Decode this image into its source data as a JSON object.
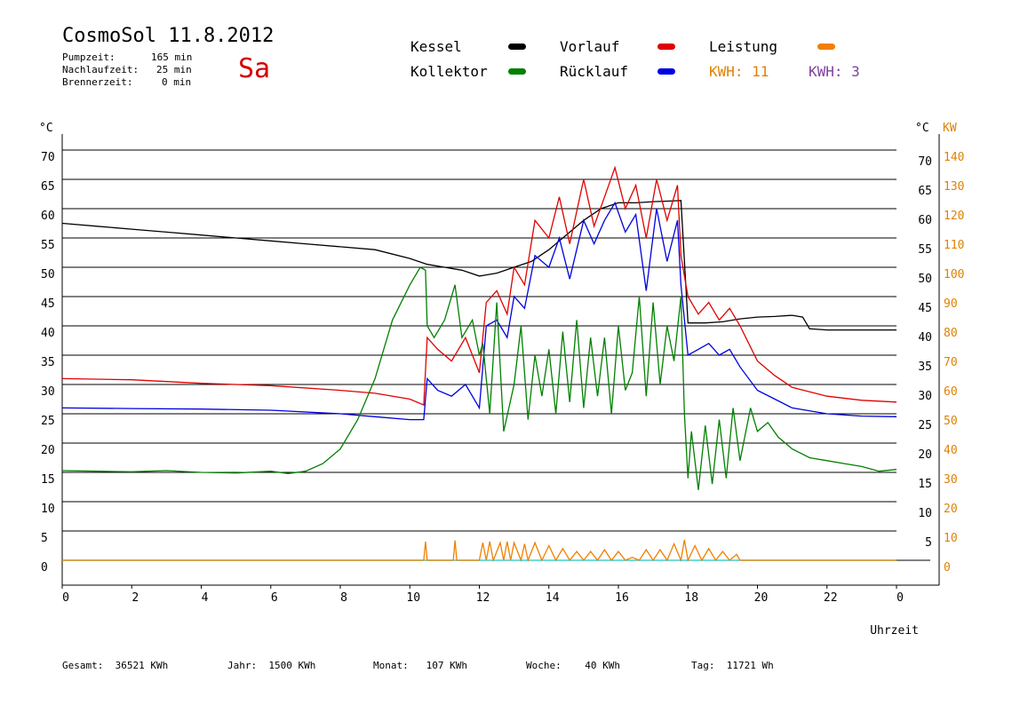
{
  "header": {
    "title": "CosmoSol 11.8.2012",
    "day": "Sa",
    "info": [
      {
        "label": "Pumpzeit:",
        "value": "165 min"
      },
      {
        "label": "Nachlaufzeit:",
        "value": "25 min"
      },
      {
        "label": "Brennerzeit:",
        "value": "0 min"
      }
    ]
  },
  "legend": {
    "kessel": {
      "label": "Kessel",
      "color": "#000000"
    },
    "vorlauf": {
      "label": "Vorlauf",
      "color": "#e00000"
    },
    "leistung": {
      "label": "Leistung",
      "color": "#f08000"
    },
    "kollektor": {
      "label": "Kollektor",
      "color": "#008000"
    },
    "ruecklauf": {
      "label": "Rücklauf",
      "color": "#0000e0"
    },
    "kwh1": {
      "label": "KWH:",
      "value": "11",
      "color": "#e08000"
    },
    "kwh2": {
      "label": "KWH:",
      "value": "3",
      "color": "#8040a0"
    }
  },
  "footer": {
    "gesamt": {
      "label": "Gesamt:",
      "value": "36521 KWh"
    },
    "jahr": {
      "label": "Jahr:",
      "value": "1500 KWh"
    },
    "monat": {
      "label": "Monat:",
      "value": "107 KWh"
    },
    "woche": {
      "label": "Woche:",
      "value": "40 KWh"
    },
    "tag": {
      "label": "Tag:",
      "value": "11721 Wh"
    }
  },
  "chart_data": {
    "type": "line",
    "xlabel": "Uhrzeit",
    "ylabel_left": "°C",
    "ylabel_right_1": "°C",
    "ylabel_right_2": "KW",
    "x_ticks": [
      "0",
      "2",
      "4",
      "6",
      "8",
      "10",
      "12",
      "14",
      "16",
      "18",
      "20",
      "22",
      "0"
    ],
    "xlim": [
      0,
      24
    ],
    "y_ticks_left": [
      "0",
      "5",
      "10",
      "15",
      "20",
      "25",
      "30",
      "35",
      "40",
      "45",
      "50",
      "55",
      "60",
      "65",
      "70"
    ],
    "y_ticks_right_1": [
      "5",
      "10",
      "15",
      "20",
      "25",
      "30",
      "35",
      "40",
      "45",
      "50",
      "55",
      "60",
      "65",
      "70"
    ],
    "y_ticks_right_2": [
      "0",
      "10",
      "20",
      "30",
      "40",
      "50",
      "60",
      "70",
      "80",
      "90",
      "100",
      "110",
      "120",
      "130",
      "140"
    ],
    "ylim": [
      0,
      70
    ],
    "grid": true,
    "series": [
      {
        "name": "Kessel",
        "color": "#000000",
        "x": [
          0,
          1,
          2,
          3,
          4,
          5,
          6,
          7,
          8,
          9,
          10,
          10.5,
          11,
          11.5,
          12,
          12.2,
          12.5,
          13,
          13.5,
          14,
          14.5,
          15,
          15.5,
          16,
          16.5,
          17,
          17.5,
          17.8,
          18,
          18.5,
          19,
          19.5,
          20,
          20.5,
          21,
          21.3,
          21.5,
          22,
          23,
          24
        ],
        "y": [
          57.5,
          57,
          56.5,
          56,
          55.5,
          55,
          54.5,
          54,
          53.5,
          53,
          51.5,
          50.5,
          50,
          49.5,
          48.5,
          48.7,
          49,
          50,
          51,
          53,
          55.5,
          58,
          60,
          61,
          61,
          61.2,
          61.3,
          61.4,
          40.5,
          40.5,
          40.7,
          41.2,
          41.5,
          41.6,
          41.8,
          41.5,
          39.5,
          39.3,
          39.3,
          39.3
        ]
      },
      {
        "name": "Vorlauf",
        "color": "#e00000",
        "x": [
          0,
          2,
          4,
          6,
          8,
          9,
          10,
          10.4,
          10.5,
          10.8,
          11.2,
          11.6,
          12,
          12.2,
          12.5,
          12.8,
          13,
          13.3,
          13.6,
          14,
          14.3,
          14.6,
          15,
          15.3,
          15.6,
          15.9,
          16.2,
          16.5,
          16.8,
          17.1,
          17.4,
          17.7,
          17.8,
          18,
          18.3,
          18.6,
          18.9,
          19.2,
          19.5,
          20,
          20.5,
          21,
          22,
          23,
          24
        ],
        "y": [
          31,
          30.8,
          30.2,
          29.8,
          29,
          28.5,
          27.5,
          26.5,
          38,
          36,
          34,
          38,
          32,
          44,
          46,
          42,
          50,
          47,
          58,
          55,
          62,
          54,
          65,
          57,
          62,
          67,
          60,
          64,
          55,
          65,
          58,
          64,
          52,
          45,
          42,
          44,
          41,
          43,
          40,
          34,
          31.5,
          29.5,
          28,
          27.3,
          27
        ]
      },
      {
        "name": "Rücklauf",
        "color": "#0000e0",
        "x": [
          0,
          2,
          4,
          6,
          8,
          9,
          10,
          10.4,
          10.5,
          10.8,
          11.2,
          11.6,
          12,
          12.2,
          12.5,
          12.8,
          13,
          13.3,
          13.6,
          14,
          14.3,
          14.6,
          15,
          15.3,
          15.6,
          15.9,
          16.2,
          16.5,
          16.8,
          17.1,
          17.4,
          17.7,
          17.8,
          18,
          18.3,
          18.6,
          18.9,
          19.2,
          19.5,
          20,
          20.5,
          21,
          22,
          23,
          24
        ],
        "y": [
          26,
          25.9,
          25.8,
          25.6,
          25,
          24.5,
          24,
          24,
          31,
          29,
          28,
          30,
          26,
          40,
          41,
          38,
          45,
          43,
          52,
          50,
          55,
          48,
          58,
          54,
          58,
          61,
          56,
          59,
          46,
          60,
          51,
          58,
          47,
          35,
          36,
          37,
          35,
          36,
          33,
          29,
          27.5,
          26,
          25,
          24.6,
          24.5
        ]
      },
      {
        "name": "Kollektor",
        "color": "#008000",
        "x": [
          0,
          1,
          2,
          3,
          4,
          5,
          6,
          6.5,
          7,
          7.5,
          8,
          8.5,
          9,
          9.5,
          10,
          10.3,
          10.45,
          10.5,
          10.7,
          11,
          11.3,
          11.5,
          11.8,
          12,
          12.1,
          12.3,
          12.5,
          12.7,
          13,
          13.2,
          13.4,
          13.6,
          13.8,
          14,
          14.2,
          14.4,
          14.6,
          14.8,
          15,
          15.2,
          15.4,
          15.6,
          15.8,
          16,
          16.2,
          16.4,
          16.6,
          16.8,
          17,
          17.2,
          17.4,
          17.6,
          17.8,
          17.9,
          18,
          18.1,
          18.3,
          18.5,
          18.7,
          18.9,
          19.1,
          19.3,
          19.5,
          19.8,
          20,
          20.3,
          20.6,
          21,
          21.5,
          22,
          22.5,
          23,
          23.5,
          24
        ],
        "y": [
          15.3,
          15.2,
          15.1,
          15.3,
          15,
          14.9,
          15.2,
          14.8,
          15.2,
          16.5,
          19,
          24,
          31,
          41,
          47,
          50,
          49.5,
          40,
          38,
          41,
          47,
          38,
          41,
          35,
          37,
          25,
          44,
          22,
          30,
          40,
          24,
          35,
          28,
          36,
          25,
          39,
          27,
          41,
          26,
          38,
          28,
          38,
          25,
          40,
          29,
          32,
          45,
          28,
          44,
          30,
          40,
          34,
          45,
          25,
          14,
          22,
          12,
          23,
          13,
          24,
          14,
          26,
          17,
          26,
          22,
          23.5,
          21,
          19,
          17.5,
          17,
          16.5,
          16,
          15.2,
          15.5
        ]
      },
      {
        "name": "Leistung",
        "color": "#f08000",
        "x": [
          0,
          10.4,
          10.45,
          10.5,
          11.25,
          11.3,
          11.35,
          12,
          12.1,
          12.2,
          12.3,
          12.4,
          12.6,
          12.7,
          12.8,
          12.9,
          13,
          13.2,
          13.3,
          13.4,
          13.6,
          13.8,
          14,
          14.2,
          14.4,
          14.6,
          14.8,
          15,
          15.2,
          15.4,
          15.6,
          15.8,
          16,
          16.2,
          16.4,
          16.6,
          16.8,
          17,
          17.2,
          17.4,
          17.6,
          17.8,
          17.9,
          18,
          18.2,
          18.4,
          18.6,
          18.8,
          19,
          19.2,
          19.4,
          19.5,
          24
        ],
        "y": [
          0,
          0,
          3.2,
          0,
          0,
          3.4,
          0,
          0,
          3,
          0,
          3.2,
          0,
          3,
          0,
          3.2,
          0,
          3,
          0,
          2.8,
          0,
          3,
          0,
          2.5,
          0,
          2,
          0,
          1.5,
          0,
          1.5,
          0,
          1.8,
          0,
          1.5,
          0,
          0.5,
          0,
          1.8,
          0,
          1.8,
          0,
          2.8,
          0,
          3.5,
          0,
          2.5,
          0,
          2,
          0,
          1.5,
          0,
          1,
          0,
          0
        ]
      }
    ]
  }
}
